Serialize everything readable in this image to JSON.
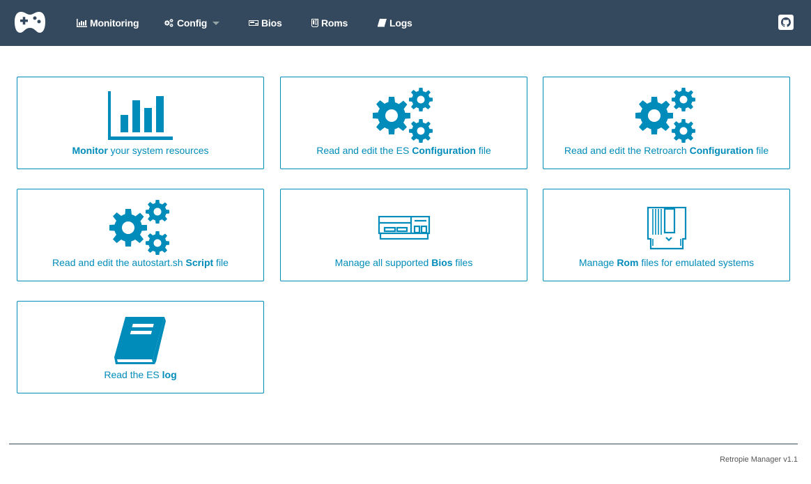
{
  "nav": {
    "brand_icon": "gamepad-icon",
    "items": [
      {
        "label": "Monitoring",
        "icon": "bar-chart-icon"
      },
      {
        "label": "Config",
        "icon": "cogs-icon"
      },
      {
        "label": "Bios",
        "icon": "console-icon"
      },
      {
        "label": "Roms",
        "icon": "cartridge-icon"
      },
      {
        "label": "Logs",
        "icon": "book-icon"
      }
    ],
    "github_icon": "github-icon"
  },
  "cards": [
    {
      "pre": "",
      "bold": "Monitor",
      "post": " your system resources",
      "icon": "bar-chart-icon"
    },
    {
      "pre": "Read and edit the ES ",
      "bold": "Configuration",
      "post": " file",
      "icon": "cogs-icon"
    },
    {
      "pre": "Read and edit the Retroarch ",
      "bold": "Configuration",
      "post": " file",
      "icon": "cogs-icon"
    },
    {
      "pre": "Read and edit the autostart.sh ",
      "bold": "Script",
      "post": " file",
      "icon": "cogs-icon"
    },
    {
      "pre": "Manage all supported ",
      "bold": "Bios",
      "post": " files",
      "icon": "console-icon"
    },
    {
      "pre": "Manage ",
      "bold": "Rom",
      "post": " files for emulated systems",
      "icon": "cartridge-icon"
    },
    {
      "pre": "Read the ES ",
      "bold": "log",
      "post": "",
      "icon": "book-icon"
    }
  ],
  "footer": {
    "text": "Retropie Manager v1.1"
  },
  "colors": {
    "navbar": "#34495e",
    "accent": "#008cba",
    "nav_text": "#ffffff"
  }
}
